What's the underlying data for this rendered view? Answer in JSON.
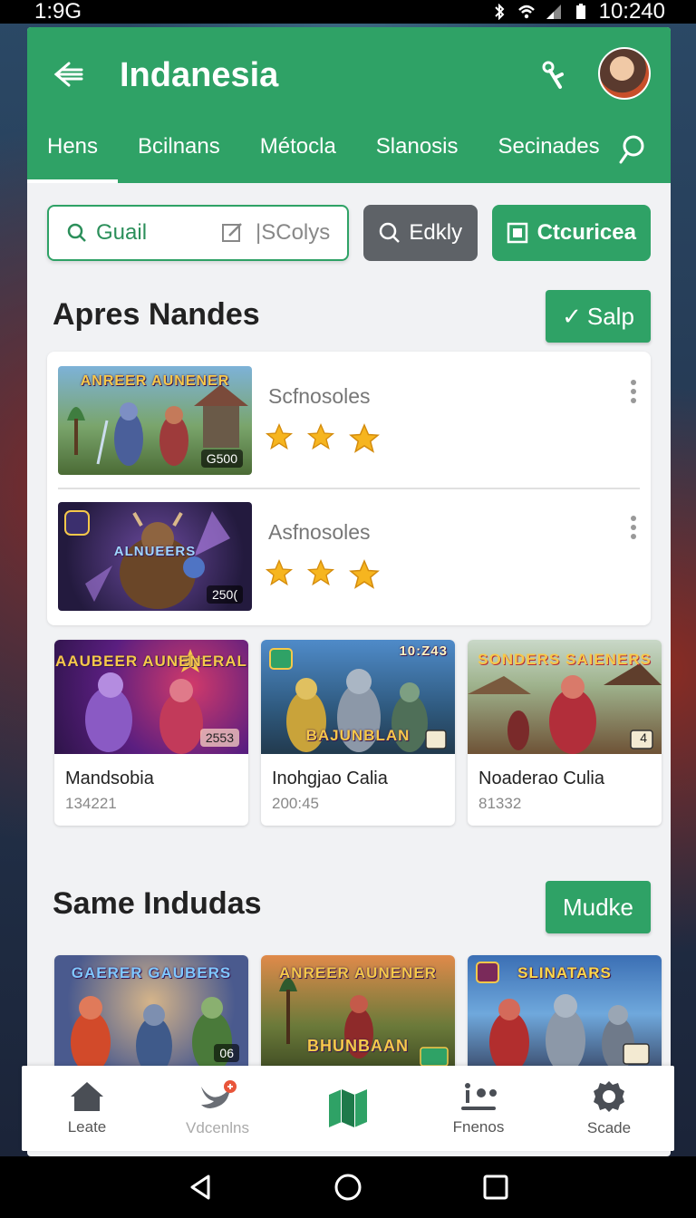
{
  "status_bar": {
    "time": "1:9G",
    "right_time": "10:240"
  },
  "appbar": {
    "title": "Indanesia",
    "tabs": [
      "Hens",
      "Bcilnans",
      "Métocla",
      "Slanosis",
      "Secinades"
    ]
  },
  "search_row": {
    "search_label": "Guail",
    "edit_label": "|SColys",
    "gray_button": "Edkly",
    "green_button": "Ctcuricea"
  },
  "section1": {
    "title": "Apres Nandes",
    "button": "Salp",
    "list": [
      {
        "name": "Scfnosoles",
        "badge": "G500",
        "art": "ANREER AUNENER",
        "stars": 3
      },
      {
        "name": "Asfnosoles",
        "badge": "250(",
        "art": "ALNUEERS",
        "stars": 3
      }
    ],
    "cards": [
      {
        "title": "Mandsobia",
        "sub": "134221",
        "badge": "2553",
        "art": "AAUBEER AUNENERAL"
      },
      {
        "title": "Inohgjao Calia",
        "sub": "200:45",
        "badge": "",
        "corner": "10:Z43",
        "art": "BAJUNBLAN"
      },
      {
        "title": "Noaderao Culia",
        "sub": "81332",
        "badge": "4",
        "art": "SONDERS SAIENERS"
      }
    ]
  },
  "section2": {
    "title": "Same Indudas",
    "button": "Mudke",
    "cards": [
      {
        "badge": "06",
        "art": "GAERER GAUBERS"
      },
      {
        "badge": "",
        "art": "BHUNBAAN"
      },
      {
        "badge": "",
        "art": "SLINATARS"
      }
    ]
  },
  "bottom_nav": [
    {
      "label": "Leate",
      "icon": "home-icon"
    },
    {
      "label": "Vdcenlns",
      "icon": "bird-icon"
    },
    {
      "label": "",
      "icon": "map-icon"
    },
    {
      "label": "Fnenos",
      "icon": "people-icon"
    },
    {
      "label": "Scade",
      "icon": "gear-icon"
    }
  ],
  "colors": {
    "accent": "#2fa266",
    "gray_button": "#5e6267",
    "star": "#f6b51f"
  }
}
